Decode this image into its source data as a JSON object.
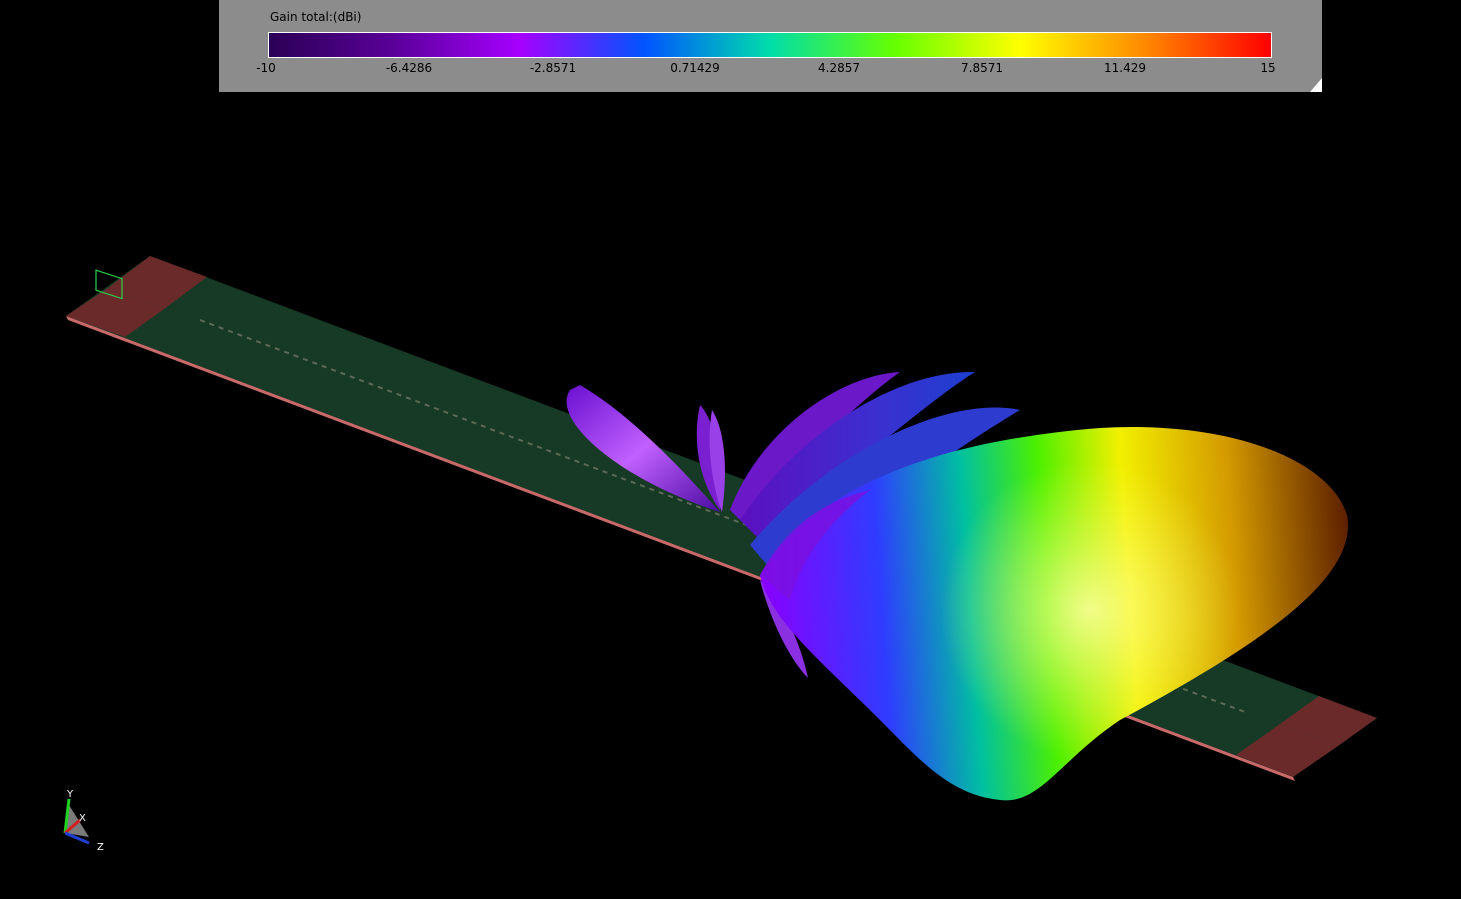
{
  "legend": {
    "title": "Gain total:(dBi)",
    "ticks": [
      "-10",
      "-6.4286",
      "-2.8571",
      "0.71429",
      "4.2857",
      "7.8571",
      "11.429",
      "15"
    ],
    "colormap": [
      "#2a0055",
      "#5a0099",
      "#a600ff",
      "#0055ff",
      "#00ddaa",
      "#66ff00",
      "#ffff00",
      "#ff8800",
      "#ff0000"
    ]
  },
  "axis_triad": {
    "labels": [
      "Y",
      "X",
      "Z"
    ]
  },
  "colors": {
    "background": "#000000",
    "panel": "#8c8c8c",
    "substrate": "#173a26",
    "port": "#6a2a2a"
  }
}
